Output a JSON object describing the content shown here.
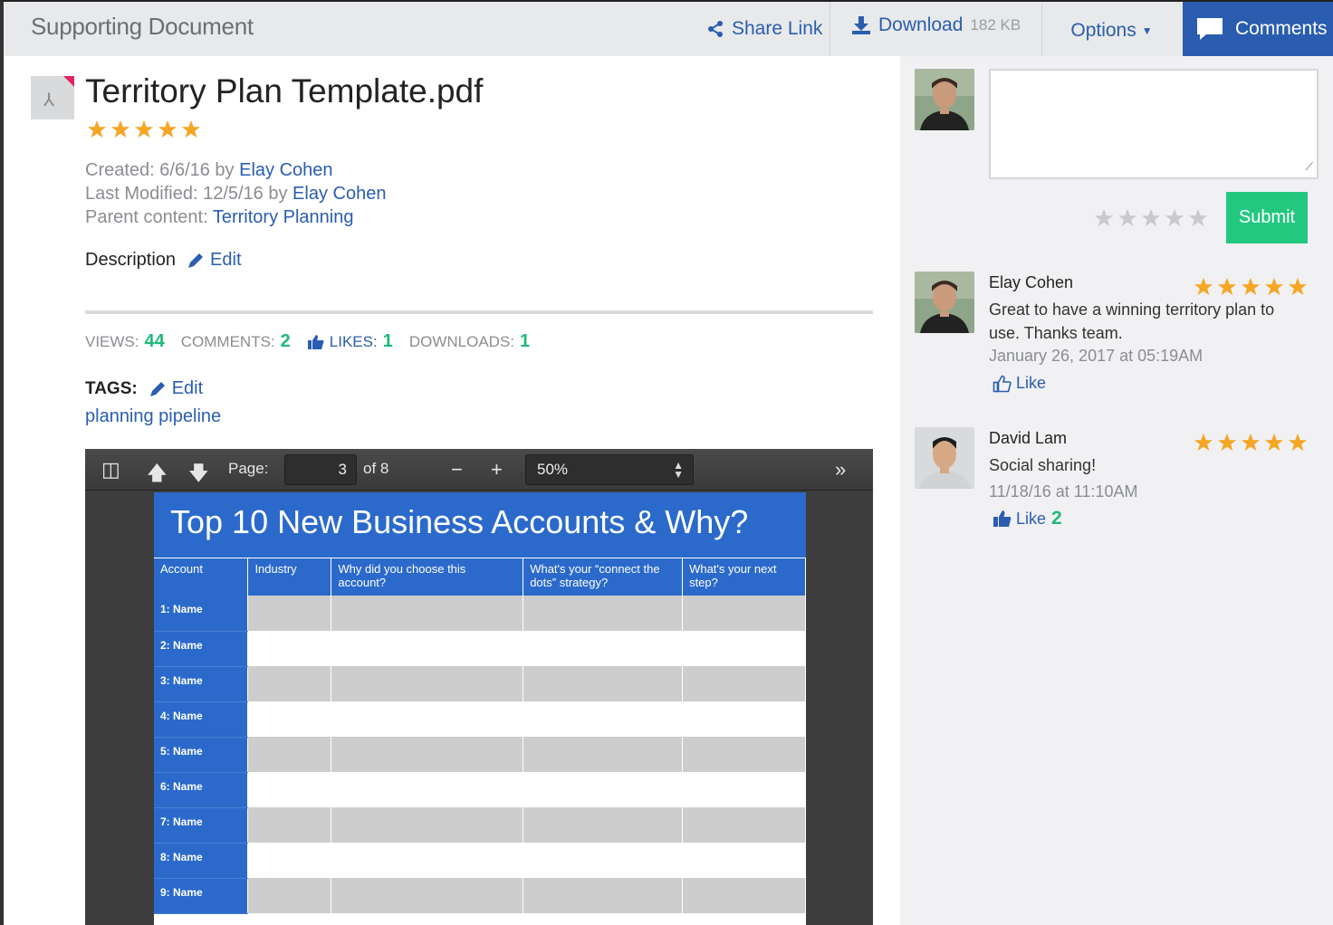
{
  "header": {
    "title": "Supporting Document",
    "share_label": "Share Link",
    "download_label": "Download",
    "download_size": "182 KB",
    "options_label": "Options",
    "comments_label": "Comments",
    "accent": "#2a5db0"
  },
  "document": {
    "title": "Territory Plan Template.pdf",
    "rating": 5,
    "created_label": "Created: 6/6/16 by",
    "created_by": "Elay Cohen",
    "modified_label": "Last Modified: 12/5/16 by",
    "modified_by": "Elay Cohen",
    "parent_label": "Parent content:",
    "parent_link": "Territory Planning",
    "description_label": "Description",
    "edit_label": "Edit",
    "stats": {
      "views_label": "VIEWS:",
      "views": "44",
      "comments_label": "COMMENTS:",
      "comments": "2",
      "likes_label": "LIKES:",
      "likes": "1",
      "downloads_label": "DOWNLOADS:",
      "downloads": "1"
    },
    "tags_label": "TAGS:",
    "tags_edit_label": "Edit",
    "tags": "planning pipeline"
  },
  "viewer": {
    "page_label": "Page:",
    "page_value": "3",
    "page_total": "of 8",
    "zoom": "50%",
    "pdf": {
      "heading": "Top 10 New Business Accounts & Why?",
      "columns": [
        "Account",
        "Industry",
        "Why did you choose this account?",
        "What's your “connect the dots” strategy?",
        "What's your next step?"
      ],
      "rows": [
        "1: Name",
        "2: Name",
        "3: Name",
        "4: Name",
        "5: Name",
        "6: Name",
        "7: Name",
        "8: Name",
        "9: Name"
      ]
    }
  },
  "sidebar": {
    "submit_label": "Submit",
    "comments": [
      {
        "name": "Elay Cohen",
        "rating": 5,
        "text": "Great to have a winning territory plan to use. Thanks team.",
        "date": "January 26, 2017 at 05:19AM",
        "like_label": "Like",
        "like_count": ""
      },
      {
        "name": "David Lam",
        "rating": 5,
        "text": "Social sharing!",
        "date": "11/18/16 at 11:10AM",
        "like_label": "Like",
        "like_count": "2"
      }
    ]
  },
  "colors": {
    "star": "#f5a623",
    "star_empty": "#c9cacc",
    "green": "#1fb97a",
    "submit": "#23c880",
    "pdf_blue": "#2b6acb"
  }
}
